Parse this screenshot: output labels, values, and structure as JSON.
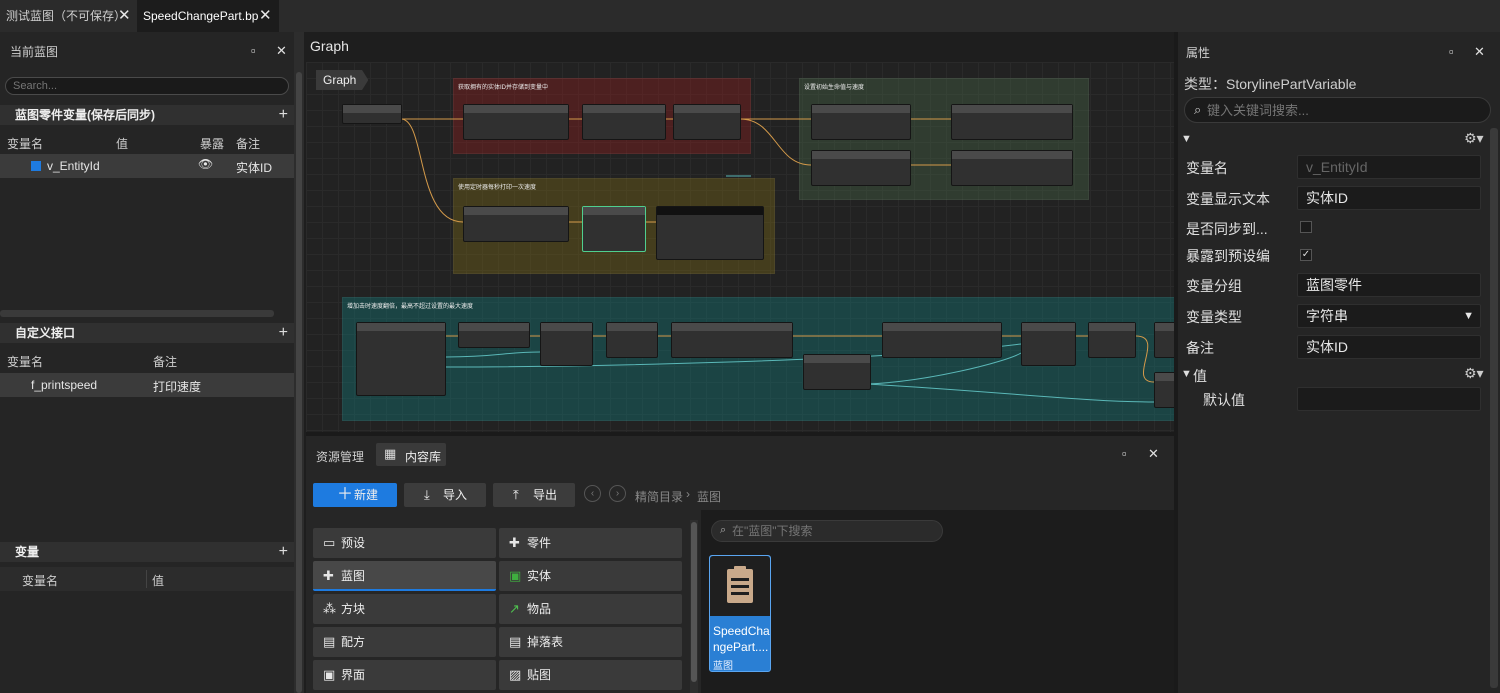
{
  "tabs": [
    {
      "label": "测试蓝图（不可保存）"
    },
    {
      "label": "SpeedChangePart.bp"
    }
  ],
  "left_panel": {
    "title": "当前蓝图",
    "search_placeholder": "Search...",
    "sections": {
      "part_vars": {
        "title": "蓝图零件变量(保存后同步)",
        "columns": [
          "变量名",
          "值",
          "暴露",
          "备注"
        ],
        "rows": [
          {
            "name": "v_EntityId",
            "note": "实体ID"
          }
        ]
      },
      "interfaces": {
        "title": "自定义接口",
        "columns": [
          "变量名",
          "备注"
        ],
        "rows": [
          {
            "name": "f_printspeed",
            "note": "打印速度"
          }
        ]
      },
      "variables": {
        "title": "变量",
        "columns": [
          "变量名",
          "值"
        ]
      }
    }
  },
  "graph": {
    "title": "Graph",
    "breadcrumb": "Graph",
    "groups": [
      {
        "title": "获取拥有的实体ID并存储到变量中"
      },
      {
        "title": "设置初始生命值与速度"
      },
      {
        "title": "使用定时器每秒打印一次速度"
      },
      {
        "title": "增加击时速度翻倍，最高不超过设置的最大速度"
      }
    ]
  },
  "content_browser": {
    "tabs": [
      "资源管理",
      "内容库"
    ],
    "new_label": "新建",
    "import_label": "导入",
    "export_label": "导出",
    "breadcrumb": [
      "精简目录",
      "蓝图"
    ],
    "search_placeholder": "在\"蓝图\"下搜索",
    "categories": [
      {
        "label": "预设",
        "icon": "preset-icon"
      },
      {
        "label": "零件",
        "icon": "part-icon"
      },
      {
        "label": "蓝图",
        "icon": "blueprint-icon"
      },
      {
        "label": "实体",
        "icon": "entity-icon"
      },
      {
        "label": "方块",
        "icon": "block-icon"
      },
      {
        "label": "物品",
        "icon": "item-icon"
      },
      {
        "label": "配方",
        "icon": "recipe-icon"
      },
      {
        "label": "掉落表",
        "icon": "loot-table-icon"
      },
      {
        "label": "界面",
        "icon": "ui-icon"
      },
      {
        "label": "贴图",
        "icon": "texture-icon"
      }
    ],
    "asset": {
      "name_line1": "SpeedCha",
      "name_line2": "ngePart....",
      "type": "蓝图"
    }
  },
  "properties": {
    "title": "属性",
    "type_label": "类型：StorylinePartVariable",
    "search_placeholder": "键入关键词搜索...",
    "fields": {
      "var_name": {
        "label": "变量名",
        "value": "v_EntityId"
      },
      "display_text": {
        "label": "变量显示文本",
        "value": "实体ID"
      },
      "sync": {
        "label": "是否同步到...",
        "checked": false
      },
      "expose": {
        "label": "暴露到预设编",
        "checked": true
      },
      "group": {
        "label": "变量分组",
        "value": "蓝图零件"
      },
      "type": {
        "label": "变量类型",
        "value": "字符串"
      },
      "note": {
        "label": "备注",
        "value": "实体ID"
      }
    },
    "value_section": "值",
    "default_label": "默认值",
    "default_value": ""
  },
  "colors": {
    "accent": "#1e7be0",
    "selected_asset": "#2a7fd4"
  }
}
